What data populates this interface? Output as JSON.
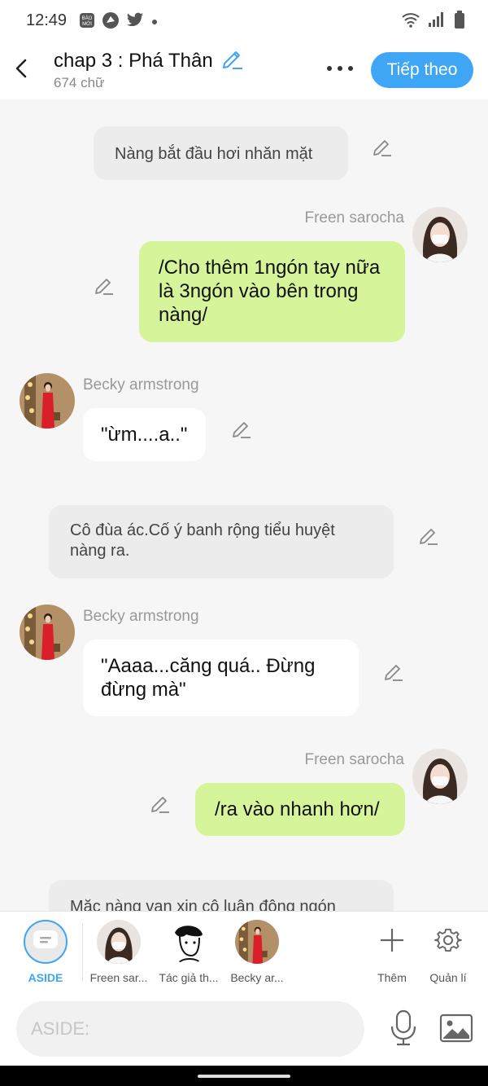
{
  "status_bar": {
    "time": "12:49",
    "left_icons": [
      "bao-moi-icon",
      "app-icon",
      "twitter-icon",
      "dot-icon"
    ],
    "right_icons": [
      "wifi-icon",
      "signal-icon",
      "battery-icon"
    ]
  },
  "header": {
    "title": "chap 3 : Phá Thân",
    "word_count": "674 chữ",
    "next_label": "Tiếp theo"
  },
  "messages": [
    {
      "type": "narration",
      "text": "Nàng bắt đầu hơi nhăn mặt"
    },
    {
      "type": "right",
      "speaker": "Freen sarocha",
      "text": "/Cho thêm 1ngón tay nữa là 3ngón vào bên trong nàng/"
    },
    {
      "type": "left",
      "speaker": "Becky armstrong",
      "text": "\"ừm....a..\""
    },
    {
      "type": "narration",
      "text": "Cô đùa ác.Cố ý banh rộng tiểu huyệt nàng ra."
    },
    {
      "type": "left",
      "speaker": "Becky armstrong",
      "text": "\"Aaaa...căng quá.. Đừng đừng mà\""
    },
    {
      "type": "right",
      "speaker": "Freen sarocha",
      "text": "/ra vào nhanh hơn/"
    },
    {
      "type": "narration",
      "text": "Mặc nàng van xin cô luận động ngón"
    }
  ],
  "characters": [
    {
      "label": "ASIDE",
      "active": true
    },
    {
      "label": "Freen sar..."
    },
    {
      "label": "Tác giả th..."
    },
    {
      "label": "Becky ar..."
    }
  ],
  "actions": {
    "add_label": "Thêm",
    "manage_label": "Quản lí"
  },
  "input": {
    "placeholder": "ASIDE:"
  },
  "colors": {
    "accent": "#3fa5f5",
    "green_bubble": "#d6f59a",
    "narration_bubble": "#ececec"
  }
}
